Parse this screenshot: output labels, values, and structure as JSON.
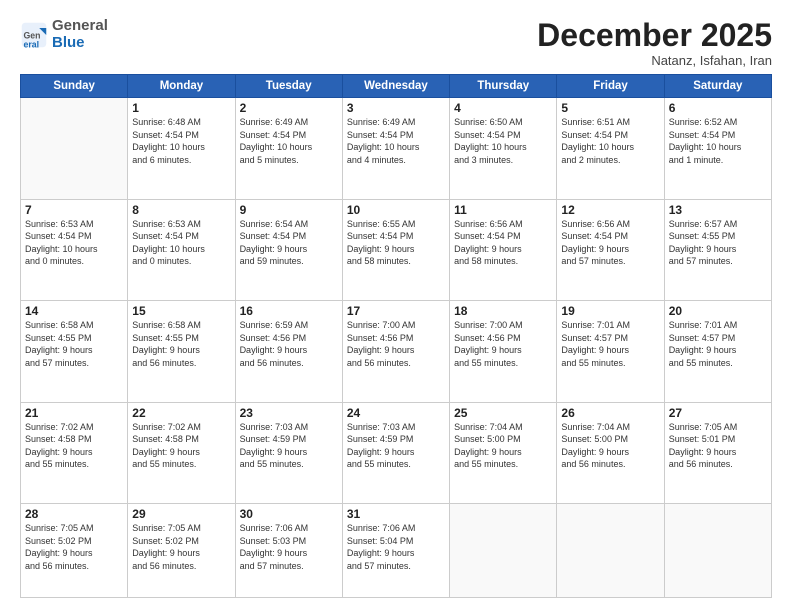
{
  "logo": {
    "general": "General",
    "blue": "Blue"
  },
  "header": {
    "month": "December 2025",
    "location": "Natanz, Isfahan, Iran"
  },
  "weekdays": [
    "Sunday",
    "Monday",
    "Tuesday",
    "Wednesday",
    "Thursday",
    "Friday",
    "Saturday"
  ],
  "weeks": [
    [
      {
        "day": "",
        "info": ""
      },
      {
        "day": "1",
        "info": "Sunrise: 6:48 AM\nSunset: 4:54 PM\nDaylight: 10 hours\nand 6 minutes."
      },
      {
        "day": "2",
        "info": "Sunrise: 6:49 AM\nSunset: 4:54 PM\nDaylight: 10 hours\nand 5 minutes."
      },
      {
        "day": "3",
        "info": "Sunrise: 6:49 AM\nSunset: 4:54 PM\nDaylight: 10 hours\nand 4 minutes."
      },
      {
        "day": "4",
        "info": "Sunrise: 6:50 AM\nSunset: 4:54 PM\nDaylight: 10 hours\nand 3 minutes."
      },
      {
        "day": "5",
        "info": "Sunrise: 6:51 AM\nSunset: 4:54 PM\nDaylight: 10 hours\nand 2 minutes."
      },
      {
        "day": "6",
        "info": "Sunrise: 6:52 AM\nSunset: 4:54 PM\nDaylight: 10 hours\nand 1 minute."
      }
    ],
    [
      {
        "day": "7",
        "info": "Sunrise: 6:53 AM\nSunset: 4:54 PM\nDaylight: 10 hours\nand 0 minutes."
      },
      {
        "day": "8",
        "info": "Sunrise: 6:53 AM\nSunset: 4:54 PM\nDaylight: 10 hours\nand 0 minutes."
      },
      {
        "day": "9",
        "info": "Sunrise: 6:54 AM\nSunset: 4:54 PM\nDaylight: 9 hours\nand 59 minutes."
      },
      {
        "day": "10",
        "info": "Sunrise: 6:55 AM\nSunset: 4:54 PM\nDaylight: 9 hours\nand 58 minutes."
      },
      {
        "day": "11",
        "info": "Sunrise: 6:56 AM\nSunset: 4:54 PM\nDaylight: 9 hours\nand 58 minutes."
      },
      {
        "day": "12",
        "info": "Sunrise: 6:56 AM\nSunset: 4:54 PM\nDaylight: 9 hours\nand 57 minutes."
      },
      {
        "day": "13",
        "info": "Sunrise: 6:57 AM\nSunset: 4:55 PM\nDaylight: 9 hours\nand 57 minutes."
      }
    ],
    [
      {
        "day": "14",
        "info": "Sunrise: 6:58 AM\nSunset: 4:55 PM\nDaylight: 9 hours\nand 57 minutes."
      },
      {
        "day": "15",
        "info": "Sunrise: 6:58 AM\nSunset: 4:55 PM\nDaylight: 9 hours\nand 56 minutes."
      },
      {
        "day": "16",
        "info": "Sunrise: 6:59 AM\nSunset: 4:56 PM\nDaylight: 9 hours\nand 56 minutes."
      },
      {
        "day": "17",
        "info": "Sunrise: 7:00 AM\nSunset: 4:56 PM\nDaylight: 9 hours\nand 56 minutes."
      },
      {
        "day": "18",
        "info": "Sunrise: 7:00 AM\nSunset: 4:56 PM\nDaylight: 9 hours\nand 55 minutes."
      },
      {
        "day": "19",
        "info": "Sunrise: 7:01 AM\nSunset: 4:57 PM\nDaylight: 9 hours\nand 55 minutes."
      },
      {
        "day": "20",
        "info": "Sunrise: 7:01 AM\nSunset: 4:57 PM\nDaylight: 9 hours\nand 55 minutes."
      }
    ],
    [
      {
        "day": "21",
        "info": "Sunrise: 7:02 AM\nSunset: 4:58 PM\nDaylight: 9 hours\nand 55 minutes."
      },
      {
        "day": "22",
        "info": "Sunrise: 7:02 AM\nSunset: 4:58 PM\nDaylight: 9 hours\nand 55 minutes."
      },
      {
        "day": "23",
        "info": "Sunrise: 7:03 AM\nSunset: 4:59 PM\nDaylight: 9 hours\nand 55 minutes."
      },
      {
        "day": "24",
        "info": "Sunrise: 7:03 AM\nSunset: 4:59 PM\nDaylight: 9 hours\nand 55 minutes."
      },
      {
        "day": "25",
        "info": "Sunrise: 7:04 AM\nSunset: 5:00 PM\nDaylight: 9 hours\nand 55 minutes."
      },
      {
        "day": "26",
        "info": "Sunrise: 7:04 AM\nSunset: 5:00 PM\nDaylight: 9 hours\nand 56 minutes."
      },
      {
        "day": "27",
        "info": "Sunrise: 7:05 AM\nSunset: 5:01 PM\nDaylight: 9 hours\nand 56 minutes."
      }
    ],
    [
      {
        "day": "28",
        "info": "Sunrise: 7:05 AM\nSunset: 5:02 PM\nDaylight: 9 hours\nand 56 minutes."
      },
      {
        "day": "29",
        "info": "Sunrise: 7:05 AM\nSunset: 5:02 PM\nDaylight: 9 hours\nand 56 minutes."
      },
      {
        "day": "30",
        "info": "Sunrise: 7:06 AM\nSunset: 5:03 PM\nDaylight: 9 hours\nand 57 minutes."
      },
      {
        "day": "31",
        "info": "Sunrise: 7:06 AM\nSunset: 5:04 PM\nDaylight: 9 hours\nand 57 minutes."
      },
      {
        "day": "",
        "info": ""
      },
      {
        "day": "",
        "info": ""
      },
      {
        "day": "",
        "info": ""
      }
    ]
  ]
}
